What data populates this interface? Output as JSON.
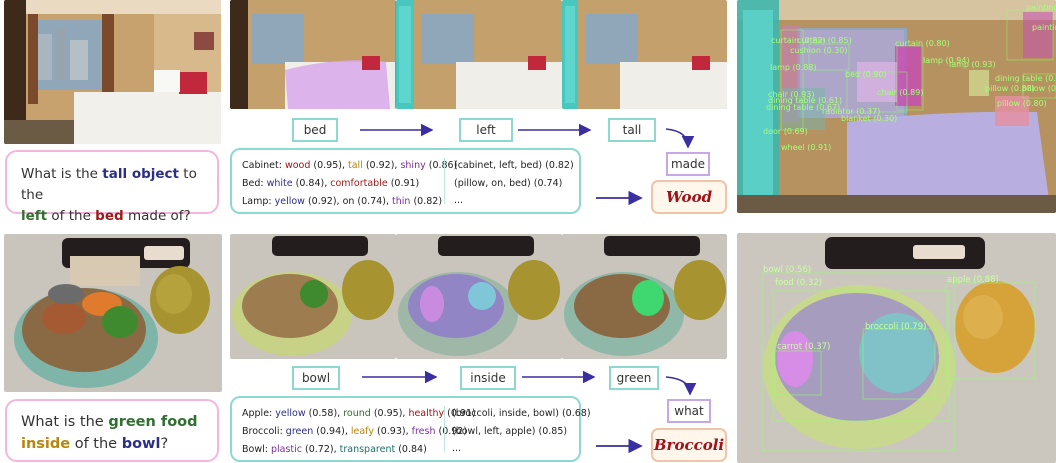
{
  "row1": {
    "question": {
      "prefix": "What is the ",
      "obj": "tall object",
      "mid1": " to the",
      "rel": "left",
      "mid2": " of the ",
      "ref": "bed",
      "suffix": " made of?"
    },
    "nodes": [
      "bed",
      "left",
      "tall",
      "made"
    ],
    "answer": "Wood",
    "kb_left": [
      {
        "label": "Cabinet: ",
        "parts": [
          {
            "t": "wood",
            "c": "red"
          },
          {
            "t": " (0.95), "
          },
          {
            "t": "tall",
            "c": "gold"
          },
          {
            "t": " (0.92), "
          },
          {
            "t": "shiny",
            "c": "purple"
          },
          {
            "t": " (0.86)"
          }
        ]
      },
      {
        "label": "Bed: ",
        "parts": [
          {
            "t": "white",
            "c": "blue"
          },
          {
            "t": " (0.84), "
          },
          {
            "t": "comfortable",
            "c": "maroon"
          },
          {
            "t": " (0.91)"
          }
        ]
      },
      {
        "label": "Lamp: ",
        "parts": [
          {
            "t": "yellow",
            "c": "blue"
          },
          {
            "t": " (0.92), on (0.74), "
          },
          {
            "t": "thin",
            "c": "purple"
          },
          {
            "t": " (0.82)"
          }
        ]
      }
    ],
    "kb_right": [
      "(cabinet, left, bed) (0.82)",
      "(pillow, on, bed) (0.74)",
      "..."
    ],
    "detections": [
      "curtain (0.82)",
      "curtain (0.85)",
      "cushion (0.30)",
      "curtain (0.80)",
      "lamp (0.88)",
      "bed (0.90)",
      "lamp (0.94)",
      "lamp (0.93)",
      "chair (0.93)",
      "dining table (0.61)",
      "chair (0.89)",
      "dining table (0.67)",
      "radiator (0.37)",
      "blanket (0.30)",
      "pillow (0.88)",
      "pillow (0.80)",
      "door (0.69)",
      "wheel (0.91)",
      "painting",
      "painting",
      "dining table (0.6",
      "pillow (0."
    ]
  },
  "row2": {
    "question": {
      "prefix": "What is the ",
      "obj": "green food",
      "rel": "inside",
      "mid": " of the ",
      "ref": "bowl",
      "suffix": "?"
    },
    "nodes": [
      "bowl",
      "inside",
      "green",
      "what"
    ],
    "answer": "Broccoli",
    "kb_left": [
      {
        "label": "Apple: ",
        "parts": [
          {
            "t": "yellow",
            "c": "blue"
          },
          {
            "t": " (0.58), "
          },
          {
            "t": "round",
            "c": "green"
          },
          {
            "t": " (0.95), "
          },
          {
            "t": "healthy",
            "c": "red"
          },
          {
            "t": " (0.91)"
          }
        ]
      },
      {
        "label": "Broccoli: ",
        "parts": [
          {
            "t": "green",
            "c": "blue"
          },
          {
            "t": " (0.94), "
          },
          {
            "t": "leafy",
            "c": "gold"
          },
          {
            "t": " (0.93), "
          },
          {
            "t": "fresh",
            "c": "purple"
          },
          {
            "t": " (0.92)"
          }
        ]
      },
      {
        "label": "Bowl: ",
        "parts": [
          {
            "t": "plastic",
            "c": "purple"
          },
          {
            "t": " (0.72), "
          },
          {
            "t": "transparent",
            "c": "teal"
          },
          {
            "t": " (0.84)"
          }
        ]
      }
    ],
    "kb_right": [
      "(broccoli, inside, bowl) (0.68)",
      "(bowl, left, apple) (0.85)",
      "..."
    ],
    "detections": [
      "bowl (0.56)",
      "food (0.32)",
      "apple (0.88)",
      "broccoli (0.79)",
      "carrot (0.37)"
    ]
  },
  "colors": {
    "node_border": "#8ed8cf",
    "node_border_purple": "#c8a7e6",
    "arrow": "#3a2ea0",
    "question_border": "#f3b7dd",
    "answer_border": "#f0c4a8",
    "answer_text": "#a0121a"
  }
}
